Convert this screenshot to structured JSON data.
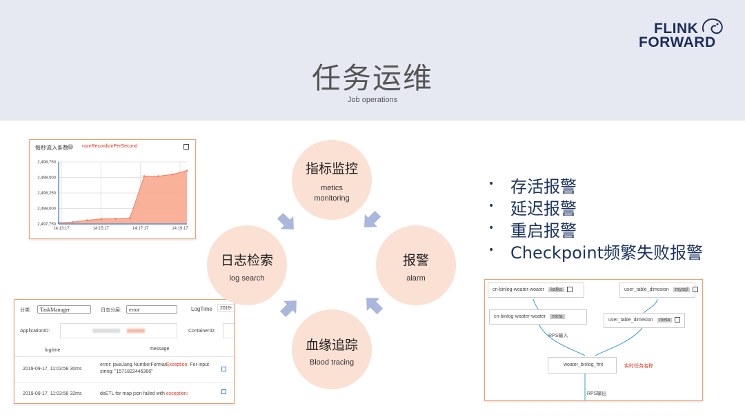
{
  "header": {
    "title": "任务运维",
    "subtitle": "Job operations",
    "logo_line1": "FLINK",
    "logo_line2": "FORWARD"
  },
  "cycle": {
    "metrics": {
      "title": "指标监控",
      "sub1": "metics",
      "sub2": "monitoring"
    },
    "alarm": {
      "title": "报警",
      "sub": "alarm"
    },
    "lineage": {
      "title": "血缘追踪",
      "sub": "Blood tracing"
    },
    "logs": {
      "title": "日志检索",
      "sub": "log search"
    }
  },
  "bullets": [
    "存活报警",
    "延迟报警",
    "重启报警",
    "Checkpoint频繁失败报警"
  ],
  "metrics_chart": {
    "header_label": "每秒流入条数",
    "metric_name": "numRecordsInPerSecond",
    "chart_data": {
      "type": "area",
      "x_ticks": [
        "14:13:17",
        "14:15:17",
        "14:17:17",
        "14:19:17"
      ],
      "y_ticks": [
        "2,497,750",
        "2,498,000",
        "2,498,250",
        "2,498,500",
        "2,498,750"
      ],
      "ylim": [
        2497750,
        2498750
      ],
      "points": [
        [
          0,
          2497770
        ],
        [
          1,
          2497780
        ],
        [
          2,
          2497810
        ],
        [
          3,
          2497830
        ],
        [
          4,
          2497835
        ],
        [
          5,
          2497845
        ],
        [
          6,
          2498520
        ],
        [
          7,
          2498520
        ],
        [
          8,
          2498550
        ],
        [
          9,
          2498610
        ]
      ],
      "color": "#f9a98e"
    }
  },
  "log_panel": {
    "cat_label": "分类:",
    "cat_value": "TaskManager",
    "logcat_label": "日志分层:",
    "logcat_value": "error",
    "logtime_label": "LogTime",
    "logtime_value": "2019-",
    "appid_label": "ApplicationID:",
    "container_label": "ContainerID:",
    "col_logtime": "logtime",
    "col_message": "message",
    "rows": [
      {
        "time": "2019-09-17, 11:03:58 30ms",
        "msg_a": "error: java.lang.NumberFormat",
        "msg_ex": "Exception",
        "msg_b": ": For input",
        "msg_c": "string: \"1571822446366\""
      },
      {
        "time": "2019-09-17, 11:03:58 32ms",
        "msg_a": "doETL for map json failed with ",
        "msg_ex": "exception",
        "msg_b": ":",
        "msg_c": ""
      }
    ]
  },
  "lineage_panel": {
    "node1": "cn-binlog-woater-woater",
    "node1_tag": "kafka",
    "node2": "user_table_dimesion",
    "node2_tag": "mysql",
    "node3": "cn-binlog-woater-woater",
    "node3_tag": "meta",
    "node4": "user_table_dimesion",
    "node4_tag": "meta",
    "node5": "woater_binlog_fmt",
    "rps_in": "RPS输入",
    "task_name": "实时任务名称",
    "rps_out": "RPS输出"
  }
}
